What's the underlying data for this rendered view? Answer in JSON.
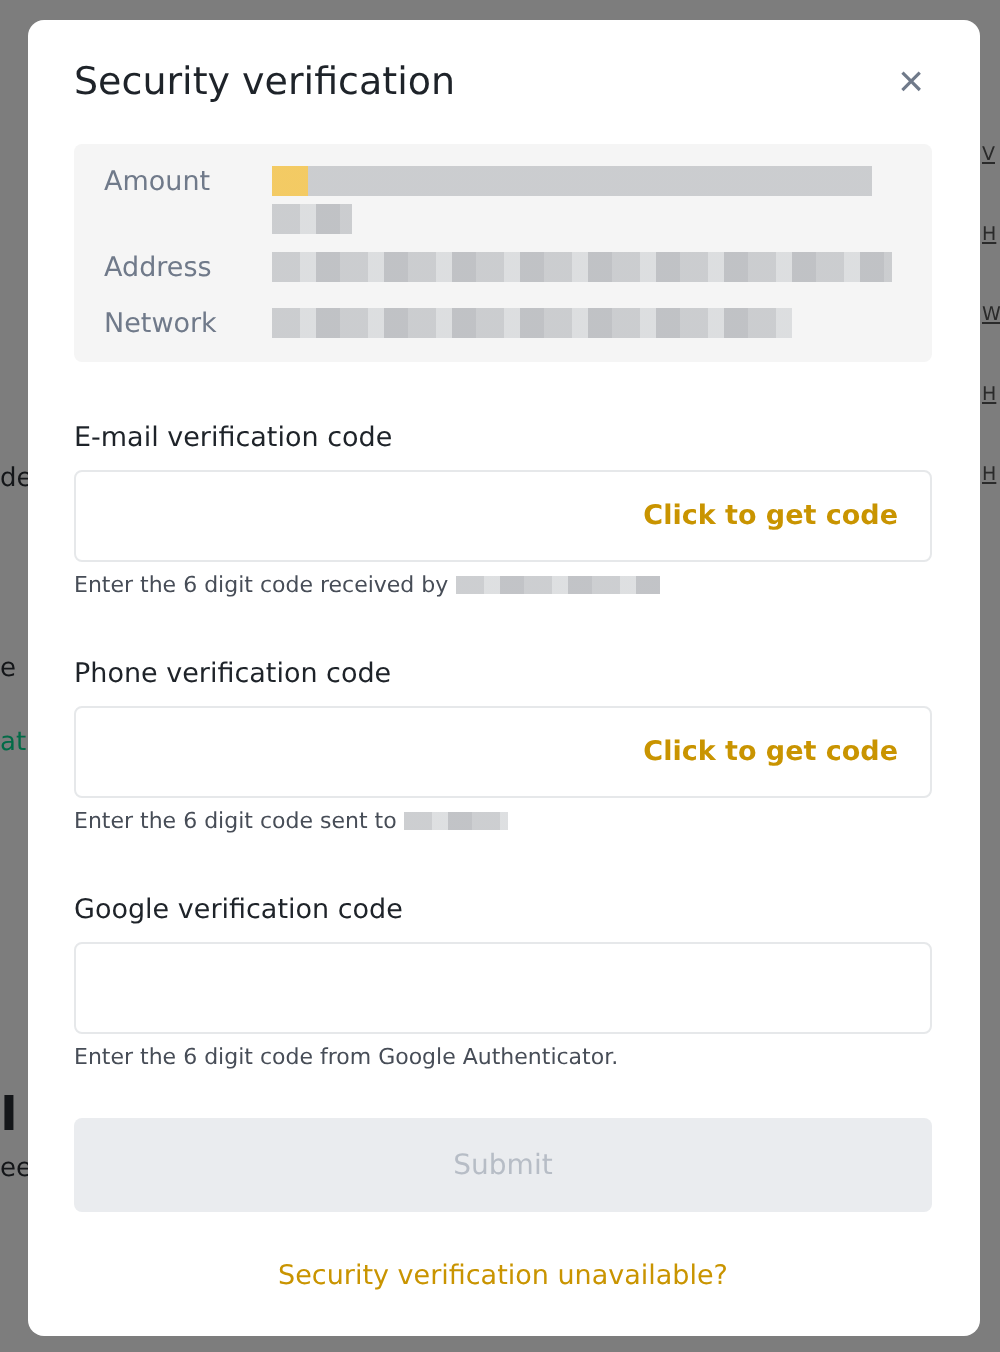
{
  "background": {
    "left_fragments": [
      {
        "text": "de",
        "color": "#141619"
      },
      {
        "text": "e",
        "color": "#141619"
      },
      {
        "text": "at",
        "color": "#026b47"
      },
      {
        "text": "I",
        "color": "#141619"
      },
      {
        "text": "ee",
        "color": "#141619"
      }
    ],
    "right_links": [
      "V",
      "H",
      "W",
      "H",
      "H"
    ]
  },
  "dialog": {
    "title": "Security verification",
    "close": "×",
    "details": [
      {
        "label": "Amount"
      },
      {
        "label": "Address"
      },
      {
        "label": "Network"
      }
    ],
    "fields": [
      {
        "label": "E-mail verification code",
        "action": "Click to get code",
        "hint": "Enter the 6 digit code received by"
      },
      {
        "label": "Phone verification code",
        "action": "Click to get code",
        "hint": "Enter the 6 digit code sent to"
      },
      {
        "label": "Google verification code",
        "hint": "Enter the 6 digit code from Google Authenticator."
      }
    ],
    "submit": {
      "label": "Submit",
      "disabled": true
    },
    "footer_link": "Security verification unavailable?"
  }
}
